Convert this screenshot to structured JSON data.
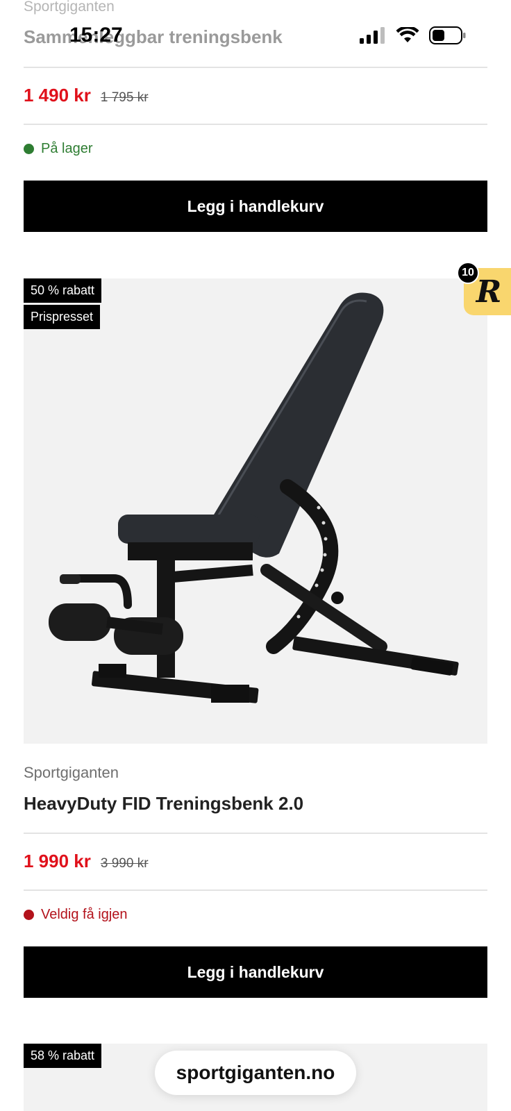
{
  "status_bar": {
    "time": "15:27"
  },
  "card1": {
    "brand": "Sportgiganten",
    "name": "Sammenleggbar treningsbenk",
    "price_now": "1 490 kr",
    "price_old": "1 795 kr",
    "stock": "På lager",
    "stock_color": "#2e7d32",
    "cart_label": "Legg i handlekurv"
  },
  "card2": {
    "badges": [
      "50 % rabatt",
      "Prispresset"
    ],
    "brand": "Sportgiganten",
    "name": "HeavyDuty FID Treningsbenk 2.0",
    "price_now": "1 990 kr",
    "price_old": "3 990 kr",
    "stock": "Veldig få igjen",
    "stock_color": "#b3121b",
    "cart_label": "Legg i handlekurv"
  },
  "card3": {
    "badges": [
      "58 % rabatt"
    ]
  },
  "reward_widget": {
    "count": "10",
    "letter": "R"
  },
  "browser": {
    "url": "sportgiganten.no"
  },
  "colors": {
    "sale_price": "#e0111b",
    "button_bg": "#000000",
    "reward_bg": "#f9d66e"
  }
}
